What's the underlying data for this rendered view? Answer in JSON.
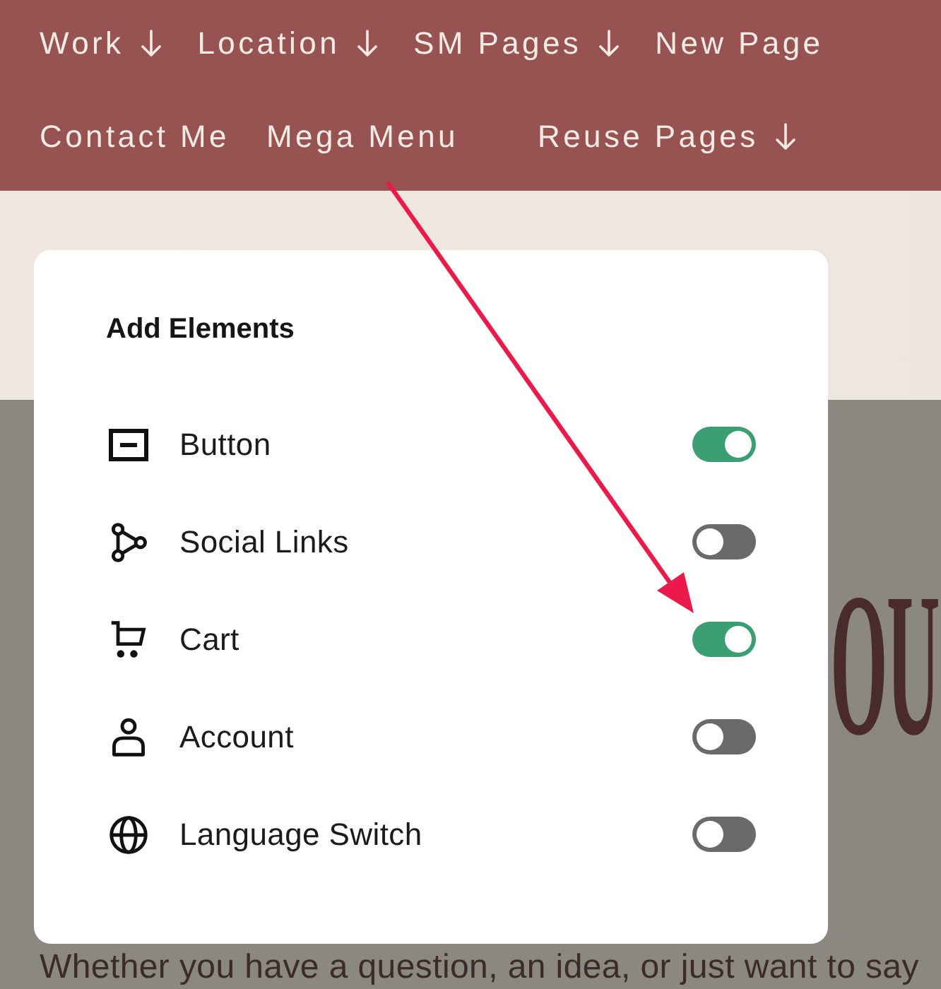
{
  "nav": {
    "items": [
      {
        "label": "Work",
        "has_dropdown": true
      },
      {
        "label": "Location",
        "has_dropdown": true
      },
      {
        "label": "SM Pages",
        "has_dropdown": true
      },
      {
        "label": "New Page",
        "has_dropdown": false
      },
      {
        "label": "Contact Me",
        "has_dropdown": false
      },
      {
        "label": "Mega Menu",
        "has_dropdown": false
      },
      {
        "label": "Reuse Pages",
        "has_dropdown": true
      }
    ]
  },
  "panel": {
    "title": "Add Elements",
    "items": [
      {
        "label": "Button",
        "kind": "button",
        "on": true
      },
      {
        "label": "Social Links",
        "kind": "nodes",
        "on": false
      },
      {
        "label": "Cart",
        "kind": "cart",
        "on": true
      },
      {
        "label": "Account",
        "kind": "person",
        "on": false
      },
      {
        "label": "Language Switch",
        "kind": "globe",
        "on": false
      }
    ]
  },
  "hero": {
    "heading": "OU",
    "text": "Whether you have a question, an idea, or just want to say"
  }
}
